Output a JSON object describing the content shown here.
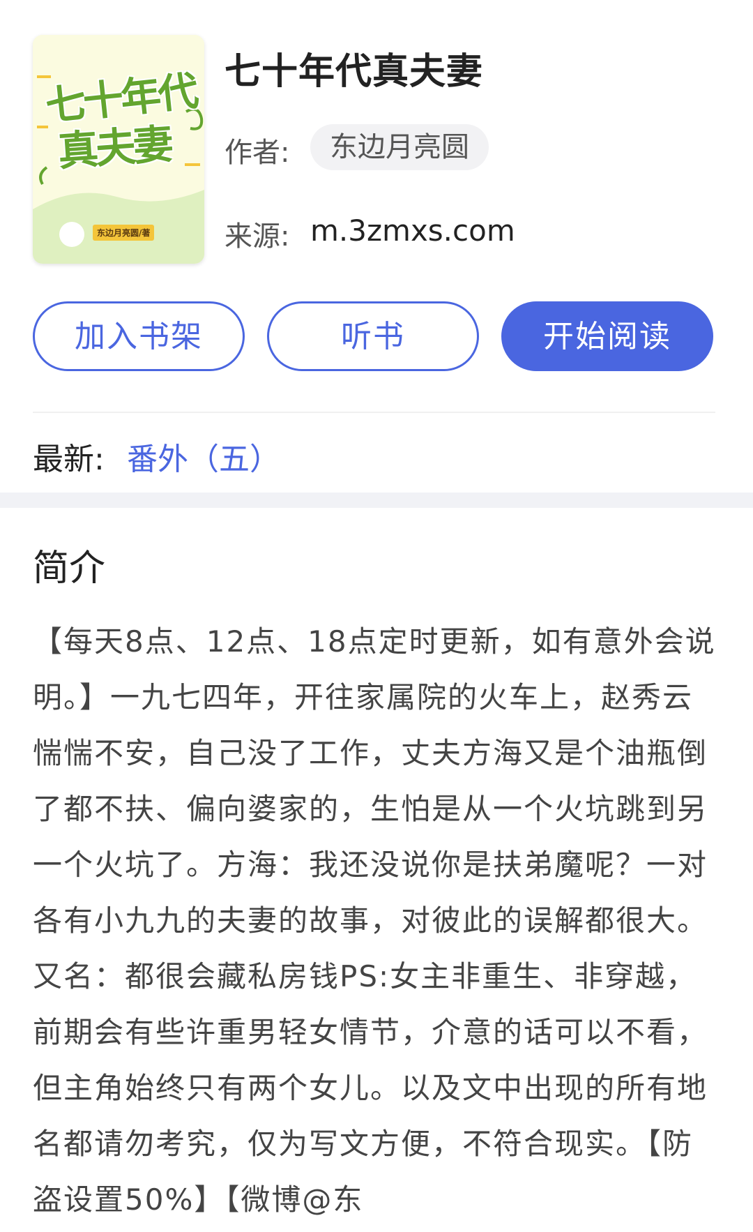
{
  "cover": {
    "title_line1": "七十年代",
    "title_line2": "真夫妻",
    "stamp": "东边月亮圆/著",
    "colors": {
      "bg": "#fbfbe0",
      "hill": "#dff0c0",
      "title": "#63a52f",
      "stamp": "#f4c53a"
    }
  },
  "book": {
    "title": "七十年代真夫妻",
    "author_label": "作者:",
    "author": "东边月亮圆",
    "source_label": "来源:",
    "source": "m.3zmxs.com"
  },
  "actions": {
    "add_shelf": "加入书架",
    "listen": "听书",
    "start_reading": "开始阅读"
  },
  "latest": {
    "label": "最新:",
    "chapter": "番外（五）"
  },
  "intro": {
    "heading": "简介",
    "text": "【每天8点、12点、18点定时更新，如有意外会说明。】一九七四年，开往家属院的火车上，赵秀云惴惴不安，自己没了工作，丈夫方海又是个油瓶倒了都不扶、偏向婆家的，生怕是从一个火坑跳到另一个火坑了。方海：我还没说你是扶弟魔呢？一对各有小九九的夫妻的故事，对彼此的误解都很大。又名：都很会藏私房钱PS:女主非重生、非穿越，前期会有些许重男轻女情节，介意的话可以不看，但主角始终只有两个女儿。以及文中出现的所有地名都请勿考究，仅为写文方便，不符合现实。【防盗设置50%】【微博@东"
  },
  "colors": {
    "accent": "#4a66e0",
    "divider": "#f0f0f0",
    "band": "#f1f2f6"
  }
}
